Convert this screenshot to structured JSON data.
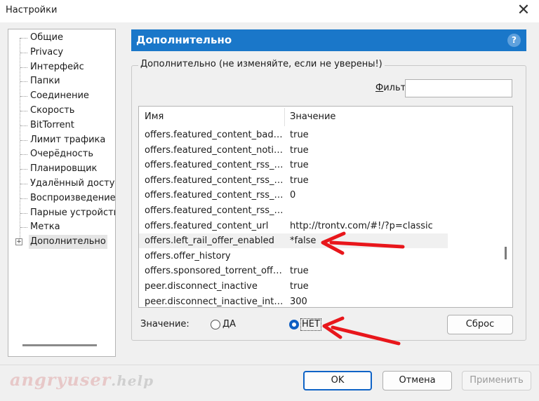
{
  "window": {
    "title": "Настройки",
    "close_glyph": "✕"
  },
  "sidebar": {
    "items": [
      {
        "label": "Общие"
      },
      {
        "label": "Privacy"
      },
      {
        "label": "Интерфейс"
      },
      {
        "label": "Папки"
      },
      {
        "label": "Соединение"
      },
      {
        "label": "Скорость"
      },
      {
        "label": "BitTorrent"
      },
      {
        "label": "Лимит трафика"
      },
      {
        "label": "Очерёдность"
      },
      {
        "label": "Планировщик"
      },
      {
        "label": "Удалённый доступ"
      },
      {
        "label": "Воспроизведение"
      },
      {
        "label": "Парные устройства"
      },
      {
        "label": "Метка"
      },
      {
        "label": "Дополнительно",
        "selected": true,
        "expander": "+"
      }
    ]
  },
  "section": {
    "title": "Дополнительно",
    "help_glyph": "?"
  },
  "group": {
    "title": "Дополнительно (не изменяйте, если не уверены!)",
    "filter_label_underlined": "Ф",
    "filter_label_rest": "ильтр",
    "filter_value": ""
  },
  "list": {
    "columns": [
      "Имя",
      "Значение"
    ],
    "rows": [
      {
        "name": "offers.featured_content_badge...",
        "value": "true"
      },
      {
        "name": "offers.featured_content_notific...",
        "value": "true"
      },
      {
        "name": "offers.featured_content_rss_en...",
        "value": "true"
      },
      {
        "name": "offers.featured_content_rss_ra...",
        "value": "true"
      },
      {
        "name": "offers.featured_content_rss_up...",
        "value": "0"
      },
      {
        "name": "offers.featured_content_rss_url",
        "value": ""
      },
      {
        "name": "offers.featured_content_url",
        "value": "http://trontv.com/#!/?p=classic"
      },
      {
        "name": "offers.left_rail_offer_enabled",
        "value": "*false",
        "highlight": true
      },
      {
        "name": "offers.offer_history",
        "value": ""
      },
      {
        "name": "offers.sponsored_torrent_offer...",
        "value": "true"
      },
      {
        "name": "peer.disconnect_inactive",
        "value": "true"
      },
      {
        "name": "peer.disconnect_inactive_inter...",
        "value": "300"
      }
    ]
  },
  "value_editor": {
    "label": "Значение:",
    "options": [
      {
        "label": "ДА",
        "checked": false
      },
      {
        "label": "НЕТ",
        "checked": true
      }
    ],
    "reset_label": "Сброс"
  },
  "footer": {
    "ok_label": "OK",
    "cancel_label": "Отмена",
    "apply_label": "Применить",
    "watermark_main": "angryuser",
    "watermark_suffix": ".help"
  },
  "colors": {
    "accent": "#1a77c9",
    "arrow": "#e8161b",
    "radio": "#0f5fc3"
  }
}
